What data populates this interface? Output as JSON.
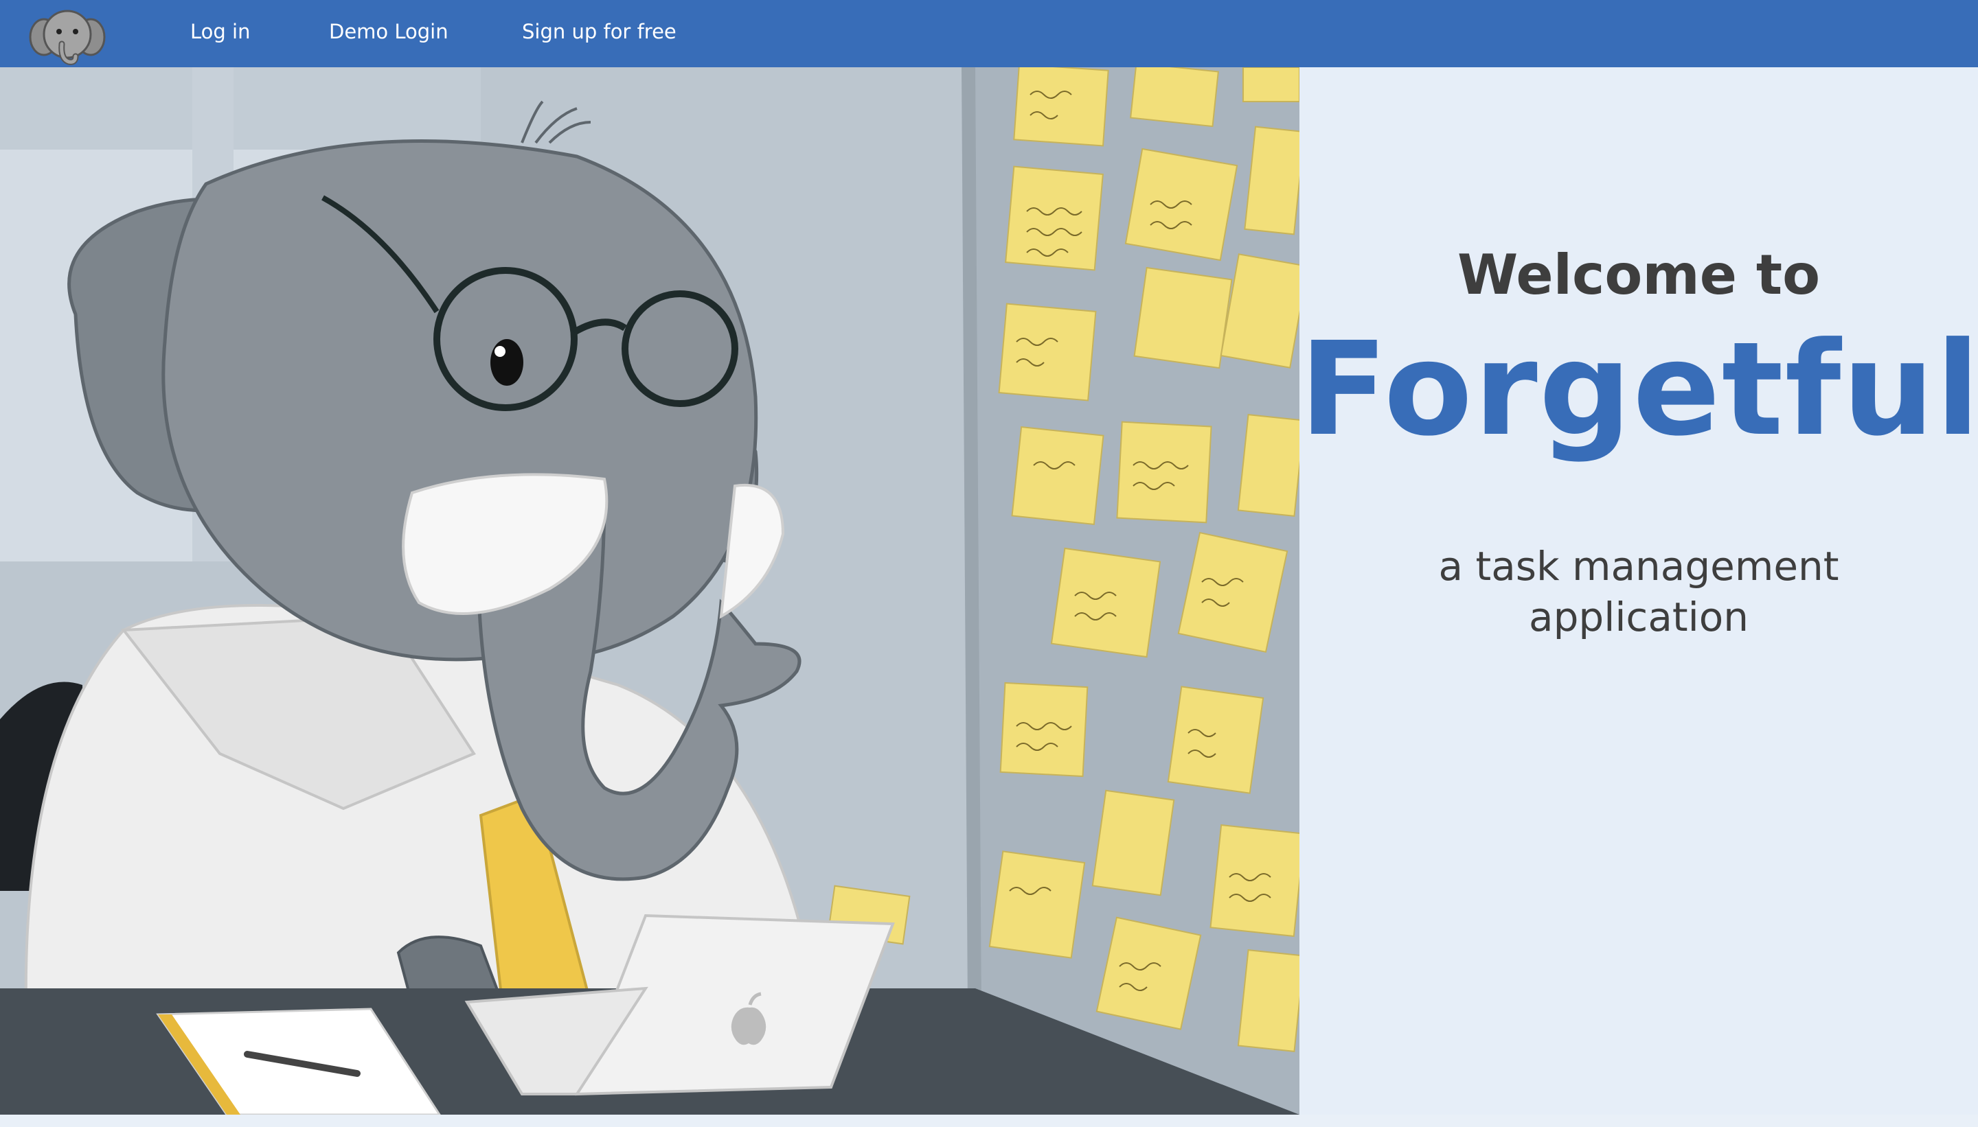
{
  "navbar": {
    "logo_icon": "elephant-head-icon",
    "links": [
      {
        "label": "Log in"
      },
      {
        "label": "Demo Login"
      },
      {
        "label": "Sign up for free"
      }
    ],
    "background": "#386db8"
  },
  "hero": {
    "illustration": "elephant-at-laptop-with-sticky-notes"
  },
  "welcome": {
    "line1": "Welcome to",
    "brand": "Forgetful",
    "tagline": "a task management application"
  },
  "colors": {
    "accent": "#386db8",
    "text": "#3e3e3e",
    "panel": "#e6eef8",
    "sticky_note": "#f2df7a"
  }
}
